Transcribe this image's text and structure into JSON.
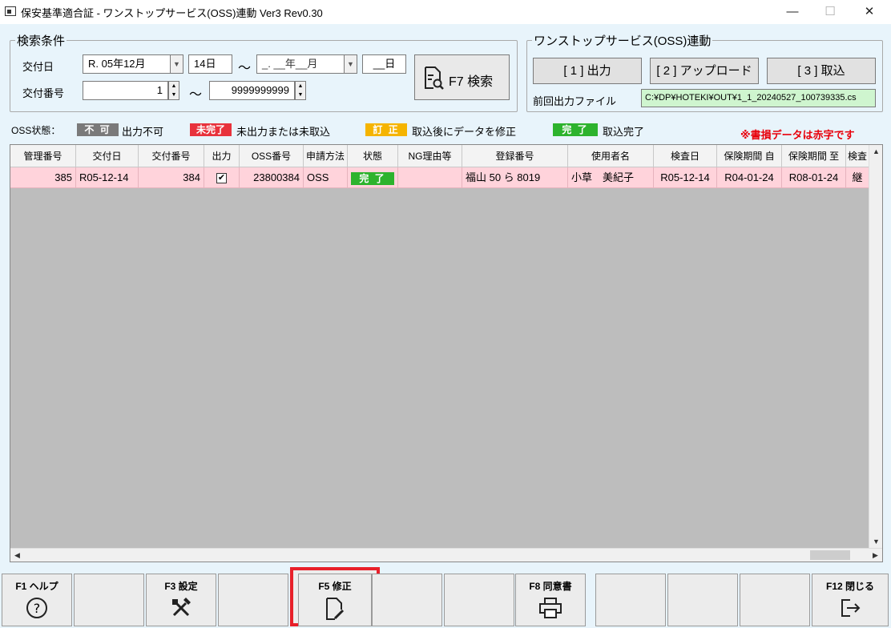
{
  "window": {
    "title": "保安基準適合証 - ワンストップサービス(OSS)連動 Ver3 Rev0.30",
    "minimize": "—",
    "maximize": "☐",
    "close": "✕"
  },
  "search": {
    "legend": "検索条件",
    "date_label": "交付日",
    "date_from_era_month": "R. 05年12月",
    "date_from_day": "14日",
    "tilde": "～",
    "date_to_era_month": "_. __年__月",
    "date_to_day": "__日",
    "number_label": "交付番号",
    "number_from": "1",
    "number_to": "9999999999",
    "search_button": "F7 検索"
  },
  "oss": {
    "legend": "ワンストップサービス(OSS)連動",
    "output_button": "[ 1 ] 出力",
    "upload_button": "[ 2 ] アップロード",
    "import_button": "[ 3 ] 取込",
    "last_file_label": "前回出力ファイル",
    "last_file_value": "C:¥DP¥HOTEKI¥OUT¥1_1_20240527_100739335.cs"
  },
  "status_legend": {
    "label": "OSS状態：",
    "items": [
      {
        "badge": "不 可",
        "text": "出力不可",
        "color": "#7a7a7a"
      },
      {
        "badge": "未完了",
        "text": "未出力または未取込",
        "color": "#e8323c"
      },
      {
        "badge": "訂 正",
        "text": "取込後にデータを修正",
        "color": "#f5b400"
      },
      {
        "badge": "完 了",
        "text": "取込完了",
        "color": "#2db32d"
      }
    ],
    "note": "※書損データは赤字です",
    "note_color": "#e8000b"
  },
  "grid": {
    "headers": [
      "管理番号",
      "交付日",
      "交付番号",
      "出力",
      "OSS番号",
      "申請方法",
      "状態",
      "NG理由等",
      "登録番号",
      "使用者名",
      "検査日",
      "保険期間 自",
      "保険期間 至",
      "検査"
    ],
    "rows": [
      {
        "kanri": "385",
        "kofubi": "R05-12-14",
        "kofu_no": "384",
        "output": "✔",
        "oss_no": "23800384",
        "method": "OSS",
        "status": "完 了",
        "ng": "",
        "reg_no": "福山 50 ら 8019",
        "user": "小草　美紀子",
        "kensa": "R05-12-14",
        "ins_from": "R04-01-24",
        "ins_to": "R08-01-24",
        "extra": "継"
      }
    ]
  },
  "fkeys": [
    {
      "label": "F1 ヘルプ",
      "icon": "help-icon"
    },
    {
      "label": "",
      "icon": ""
    },
    {
      "label": "F3 設定",
      "icon": "tools-icon"
    },
    {
      "label": "",
      "icon": ""
    },
    {
      "label": "F5 修正",
      "icon": "edit-document-icon"
    },
    {
      "label": "",
      "icon": ""
    },
    {
      "label": "",
      "icon": ""
    },
    {
      "label": "F8 同意書",
      "icon": "printer-icon"
    },
    {
      "label": "",
      "icon": ""
    },
    {
      "label": "",
      "icon": ""
    },
    {
      "label": "",
      "icon": ""
    },
    {
      "label": "F12 閉じる",
      "icon": "exit-icon"
    }
  ],
  "highlight_color": "#e8202a"
}
